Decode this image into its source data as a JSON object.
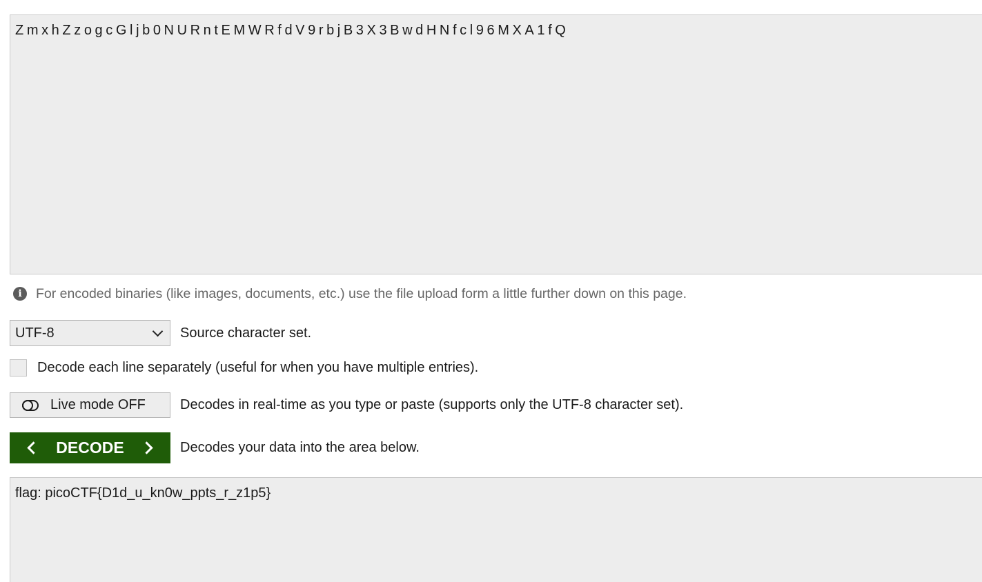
{
  "source": {
    "value": "ZmxhZzogcGljb0NURntEMWRfdV9rbjB3X3BwdHNfcl96MXA1fQ"
  },
  "info": {
    "icon": "info-icon",
    "text": "For encoded binaries (like images, documents, etc.) use the file upload form a little further down on this page."
  },
  "charset": {
    "selected": "UTF-8",
    "label": "Source character set."
  },
  "separate_lines": {
    "checked": false,
    "label": "Decode each line separately (useful for when you have multiple entries)."
  },
  "live_mode": {
    "icon": "toggle-icon",
    "button_label": "Live mode OFF",
    "description": "Decodes in real-time as you type or paste (supports only the UTF-8 character set)."
  },
  "decode": {
    "button_label": "DECODE",
    "description": "Decodes your data into the area below."
  },
  "result": {
    "value": "flag: picoCTF{D1d_u_kn0w_ppts_r_z1p5}"
  },
  "colors": {
    "decode_button": "#1f5c08",
    "field_background": "#ededed"
  }
}
